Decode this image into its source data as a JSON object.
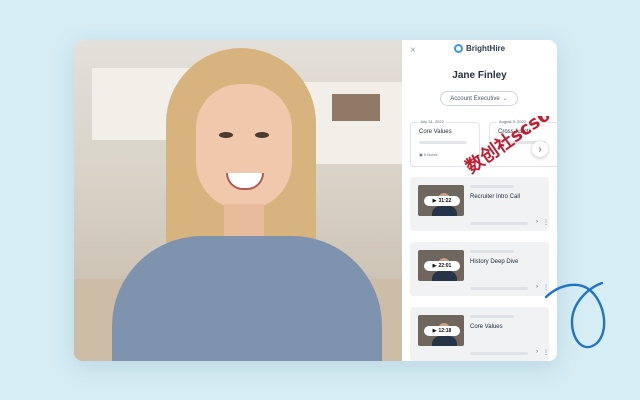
{
  "brand": {
    "name": "BrightHire",
    "accent": "#3d9adf"
  },
  "candidate": {
    "name": "Jane Finley",
    "role": "Account Executive"
  },
  "notes_cards": [
    {
      "date": "July 31, 2022",
      "title": "Core Values",
      "notes": "5 Notes"
    },
    {
      "date": "August 5, 2022",
      "title": "Cross-functi",
      "notes": ""
    }
  ],
  "clips": [
    {
      "duration": "31:22",
      "title": "Recruiter Intro Call"
    },
    {
      "duration": "22:01",
      "title": "History Deep Dive"
    },
    {
      "duration": "12:18",
      "title": "Core Values"
    }
  ],
  "watermark": {
    "text": "数创社scs66"
  },
  "colors": {
    "background": "#d6edf4",
    "decor_stroke": "#1f73c8",
    "watermark": "#bf1f35"
  }
}
